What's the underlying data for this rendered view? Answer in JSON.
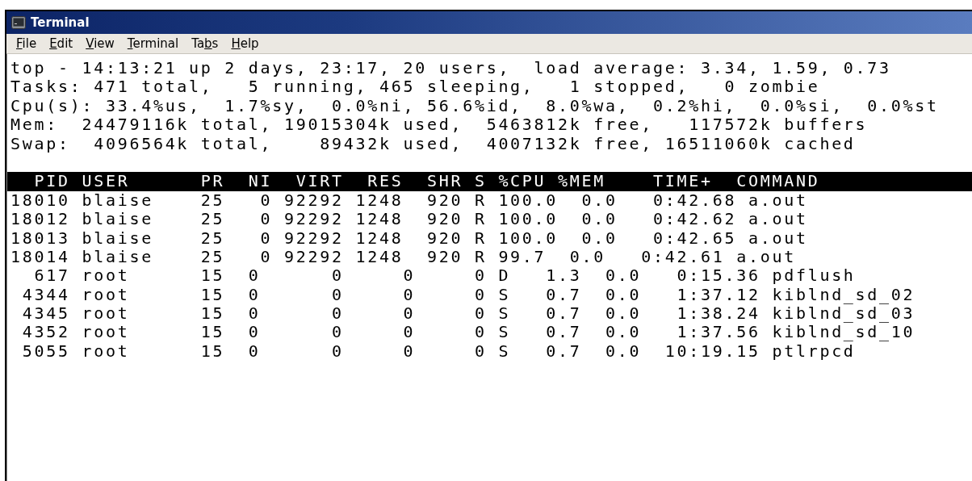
{
  "window": {
    "title": "Terminal"
  },
  "menu": [
    {
      "key": "F",
      "after": "ile"
    },
    {
      "key": "E",
      "after": "dit"
    },
    {
      "key": "V",
      "after": "iew"
    },
    {
      "key": "T",
      "after": "erminal"
    },
    {
      "before": "Ta",
      "key": "b",
      "after": "s"
    },
    {
      "key": "H",
      "after": "elp"
    }
  ],
  "summary_lines": [
    "top - 14:13:21 up 2 days, 23:17, 20 users,  load average: 3.34, 1.59, 0.73",
    "Tasks: 471 total,   5 running, 465 sleeping,   1 stopped,   0 zombie",
    "Cpu(s): 33.4%us,  1.7%sy,  0.0%ni, 56.6%id,  8.0%wa,  0.2%hi,  0.0%si,  0.0%st",
    "Mem:  24479116k total, 19015304k used,  5463812k free,   117572k buffers",
    "Swap:  4096564k total,    89432k used,  4007132k free, 16511060k cached"
  ],
  "process_header": "  PID USER      PR  NI  VIRT  RES  SHR S %CPU %MEM    TIME+  COMMAND",
  "process_lines": [
    "18010 blaise    25   0 92292 1248  920 R 100.0  0.0   0:42.68 a.out",
    "18012 blaise    25   0 92292 1248  920 R 100.0  0.0   0:42.62 a.out",
    "18013 blaise    25   0 92292 1248  920 R 100.0  0.0   0:42.65 a.out",
    "18014 blaise    25   0 92292 1248  920 R 99.7  0.0   0:42.61 a.out",
    "  617 root      15  0      0     0     0 D   1.3  0.0   0:15.36 pdflush",
    " 4344 root      15  0      0     0     0 S   0.7  0.0   1:37.12 kiblnd_sd_02",
    " 4345 root      15  0      0     0     0 S   0.7  0.0   1:38.24 kiblnd_sd_03",
    " 4352 root      15  0      0     0     0 S   0.7  0.0   1:37.56 kiblnd_sd_10",
    " 5055 root      15  0      0     0     0 S   0.7  0.0  10:19.15 ptlrpcd"
  ]
}
